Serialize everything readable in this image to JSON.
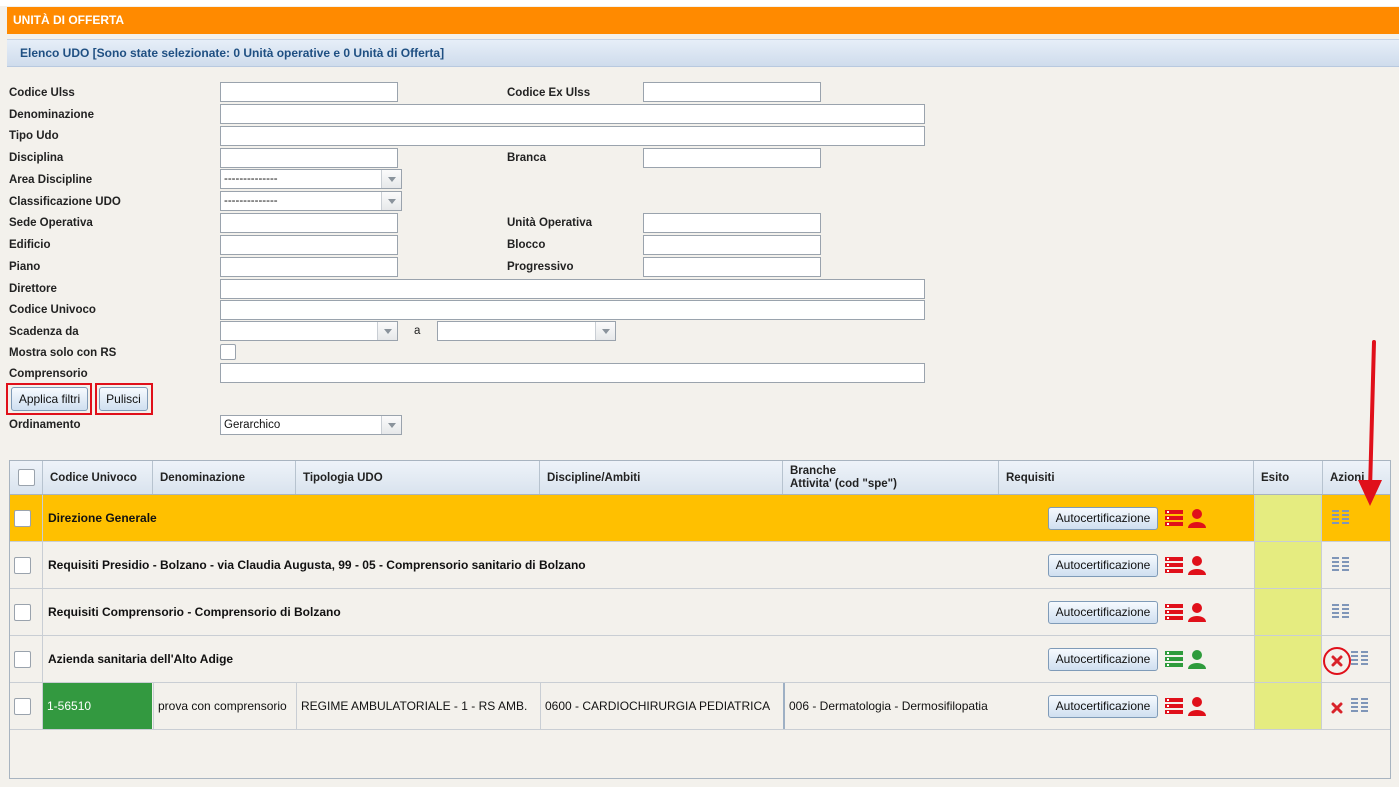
{
  "header": {
    "title": "UNITÀ DI OFFERTA"
  },
  "subheader": {
    "text": "Elenco UDO [Sono state selezionate: 0 Unità operative e 0 Unità di Offerta]"
  },
  "filters": {
    "codice_ulss": "Codice Ulss",
    "codice_ex_ulss": "Codice Ex Ulss",
    "denominazione": "Denominazione",
    "tipo_udo": "Tipo Udo",
    "disciplina": "Disciplina",
    "branca": "Branca",
    "area_discipline": "Area Discipline",
    "area_discipline_value": "--------------",
    "classificazione_udo": "Classificazione UDO",
    "classificazione_udo_value": "--------------",
    "sede_operativa": "Sede Operativa",
    "unita_operativa": "Unità Operativa",
    "edificio": "Edificio",
    "blocco": "Blocco",
    "piano": "Piano",
    "progressivo": "Progressivo",
    "direttore": "Direttore",
    "codice_univoco": "Codice Univoco",
    "scadenza_da": "Scadenza da",
    "scadenza_a": "a",
    "mostra_solo_rs": "Mostra solo con RS",
    "comprensorio": "Comprensorio",
    "ordinamento": "Ordinamento",
    "ordinamento_value": "Gerarchico"
  },
  "buttons": {
    "applica": "Applica filtri",
    "pulisci": "Pulisci"
  },
  "table": {
    "headers": {
      "codice_univoco": "Codice Univoco",
      "denominazione": "Denominazione",
      "tipologia": "Tipologia UDO",
      "discipline": "Discipline/Ambiti",
      "branche_1": "Branche",
      "branche_2": "Attivita' (cod \"spe\")",
      "requisiti": "Requisiti",
      "esito": "Esito",
      "azioni": "Azioni"
    },
    "autocert_label": "Autocertificazione",
    "rows": [
      {
        "title": "Direzione Generale"
      },
      {
        "title": "Requisiti Presidio - Bolzano - via Claudia Augusta, 99 - 05 - Comprensorio sanitario di Bolzano"
      },
      {
        "title": "Requisiti Comprensorio - Comprensorio di Bolzano"
      },
      {
        "title": "Azienda sanitaria dell'Alto Adige"
      },
      {
        "codice": "1-56510",
        "denominazione": "prova con comprensorio",
        "tipologia": "REGIME AMBULATORIALE - 1 - RS AMB.",
        "disciplina": "0600 - CARDIOCHIRURGIA PEDIATRICA",
        "branca": "006 - Dermatologia - Dermosifilopatia"
      }
    ]
  },
  "colors": {
    "orange": "#ff8a00",
    "highlight": "#ffc000",
    "esito": "#e5ec80",
    "green": "#339940",
    "red": "#e0101a"
  }
}
